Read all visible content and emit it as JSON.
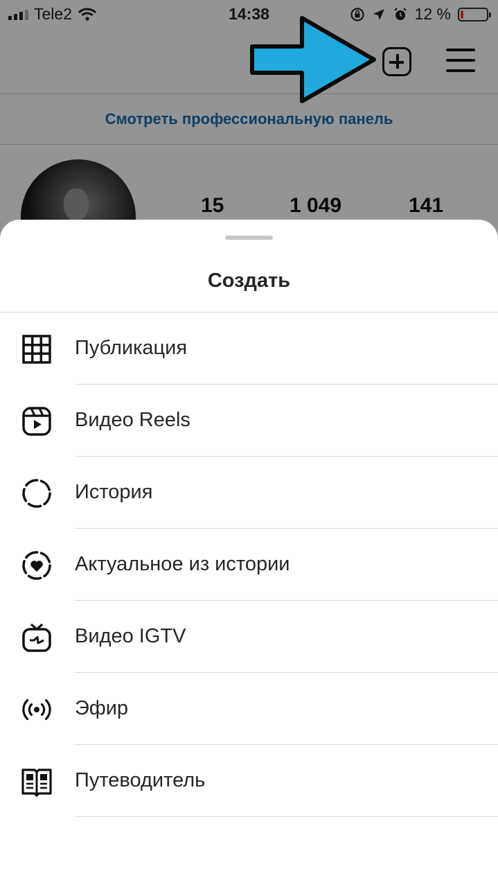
{
  "status_bar": {
    "carrier": "Tele2",
    "time": "14:38",
    "battery_text": "12 %",
    "battery_level": 0.12
  },
  "profile": {
    "pro_panel_link": "Смотреть профессиональную панель",
    "stats": [
      "15",
      "1 049",
      "141"
    ]
  },
  "sheet": {
    "title": "Создать",
    "items": [
      {
        "label": "Публикация",
        "icon": "grid-icon"
      },
      {
        "label": "Видео Reels",
        "icon": "reels-icon"
      },
      {
        "label": "История",
        "icon": "story-icon"
      },
      {
        "label": "Актуальное из истории",
        "icon": "highlight-icon"
      },
      {
        "label": "Видео IGTV",
        "icon": "igtv-icon"
      },
      {
        "label": "Эфир",
        "icon": "live-icon"
      },
      {
        "label": "Путеводитель",
        "icon": "guide-icon"
      }
    ]
  },
  "colors": {
    "arrow": "#1fa9dd",
    "link": "#1a6fb3",
    "text": "#262626",
    "battery_low": "#ff3b30"
  }
}
